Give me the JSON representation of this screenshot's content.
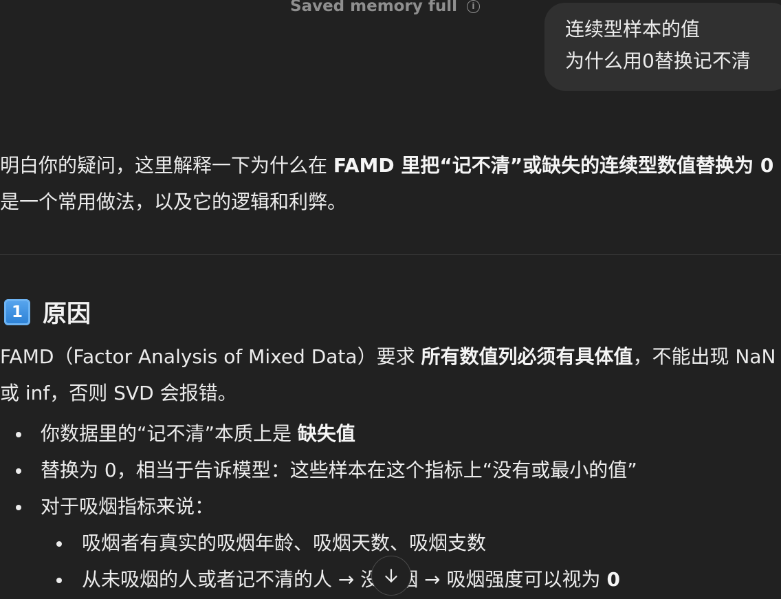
{
  "banner": {
    "text": "Saved memory full",
    "icon": "info-icon"
  },
  "user_message": {
    "line1": "连续型样本的值",
    "line2": "为什么用0替换记不清"
  },
  "intro": {
    "t1": "明白你的疑问，这里解释一下为什么在 ",
    "b1": "FAMD 里把“记不清”或缺失的连续型数值替换为 0",
    "t2": " 是一个常用做法，以及它的逻辑和利弊。"
  },
  "section": {
    "keycap": "1",
    "title": "原因"
  },
  "paragraph": {
    "t1": "FAMD（Factor Analysis of Mixed Data）要求 ",
    "b1": "所有数值列必须有具体值",
    "t2": "，不能出现 NaN 或 inf，否则 SVD 会报错。"
  },
  "bullets": {
    "item1_text": "你数据里的“记不清”本质上是 ",
    "item1_bold": "缺失值",
    "item2_text": "替换为 0，相当于告诉模型：这些样本在这个指标上“没有或最小的值”",
    "item3_text": "对于吸烟指标来说：",
    "sub1_text": "吸烟者有真实的吸烟年龄、吸烟天数、吸烟支数",
    "sub2_text": "从未吸烟的人或者记不清的人 → 没吸烟 → 吸烟强度可以视为 ",
    "sub2_bold": "0"
  },
  "scroll_button": {
    "icon": "arrow-down-icon"
  }
}
